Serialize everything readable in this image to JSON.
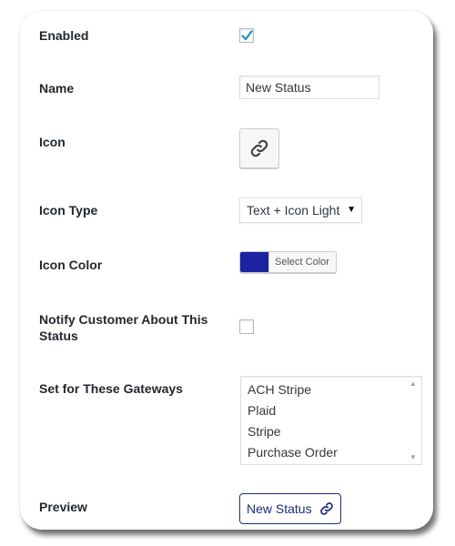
{
  "form": {
    "enabled": {
      "label": "Enabled",
      "checked": true
    },
    "name": {
      "label": "Name",
      "value": "New Status"
    },
    "icon": {
      "label": "Icon",
      "icon_name": "link-icon"
    },
    "icon_type": {
      "label": "Icon Type",
      "selected": "Text + Icon Light"
    },
    "icon_color": {
      "label": "Icon Color",
      "color": "#1c22a0",
      "button_label": "Select Color"
    },
    "notify": {
      "label": "Notify Customer About This Status",
      "checked": false
    },
    "gateways": {
      "label": "Set for These Gateways",
      "options": [
        "ACH Stripe",
        "Plaid",
        "Stripe",
        "Purchase Order"
      ]
    },
    "preview": {
      "label": "Preview",
      "text": "New Status",
      "icon_name": "link-icon",
      "color": "#1b2d7a"
    }
  },
  "colors": {
    "checkmark": "#1e8cbe",
    "label_text": "#23282d"
  }
}
